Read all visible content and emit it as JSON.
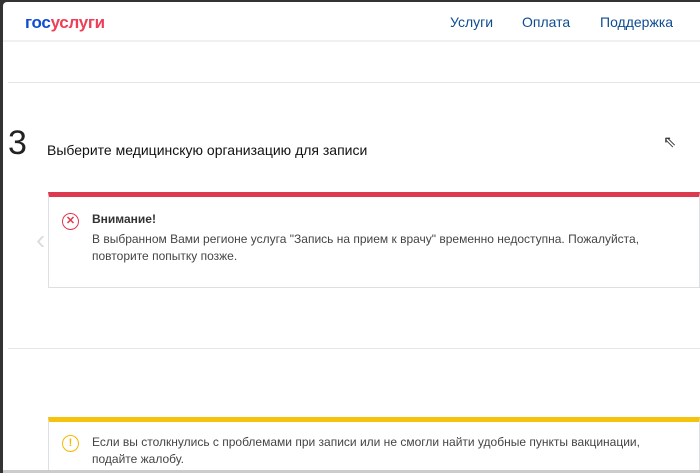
{
  "header": {
    "logo_a": "гос",
    "logo_b": "услуги",
    "nav": [
      "Услуги",
      "Оплата",
      "Поддержка"
    ]
  },
  "step": {
    "number": "3",
    "title": "Выберите медицинскую организацию для записи"
  },
  "error_alert": {
    "heading": "Внимание!",
    "text": "В выбранном Вами регионе услуга \"Запись на прием к врачу\" временно недоступна. Пожалуйста, повторите попытку позже.",
    "color": "#de3a4f"
  },
  "warning_alert": {
    "text": "Если вы столкнулись с проблемами при записи или не смогли найти удобные пункты вакцинации, подайте жалобу.",
    "color": "#f5c30b"
  }
}
